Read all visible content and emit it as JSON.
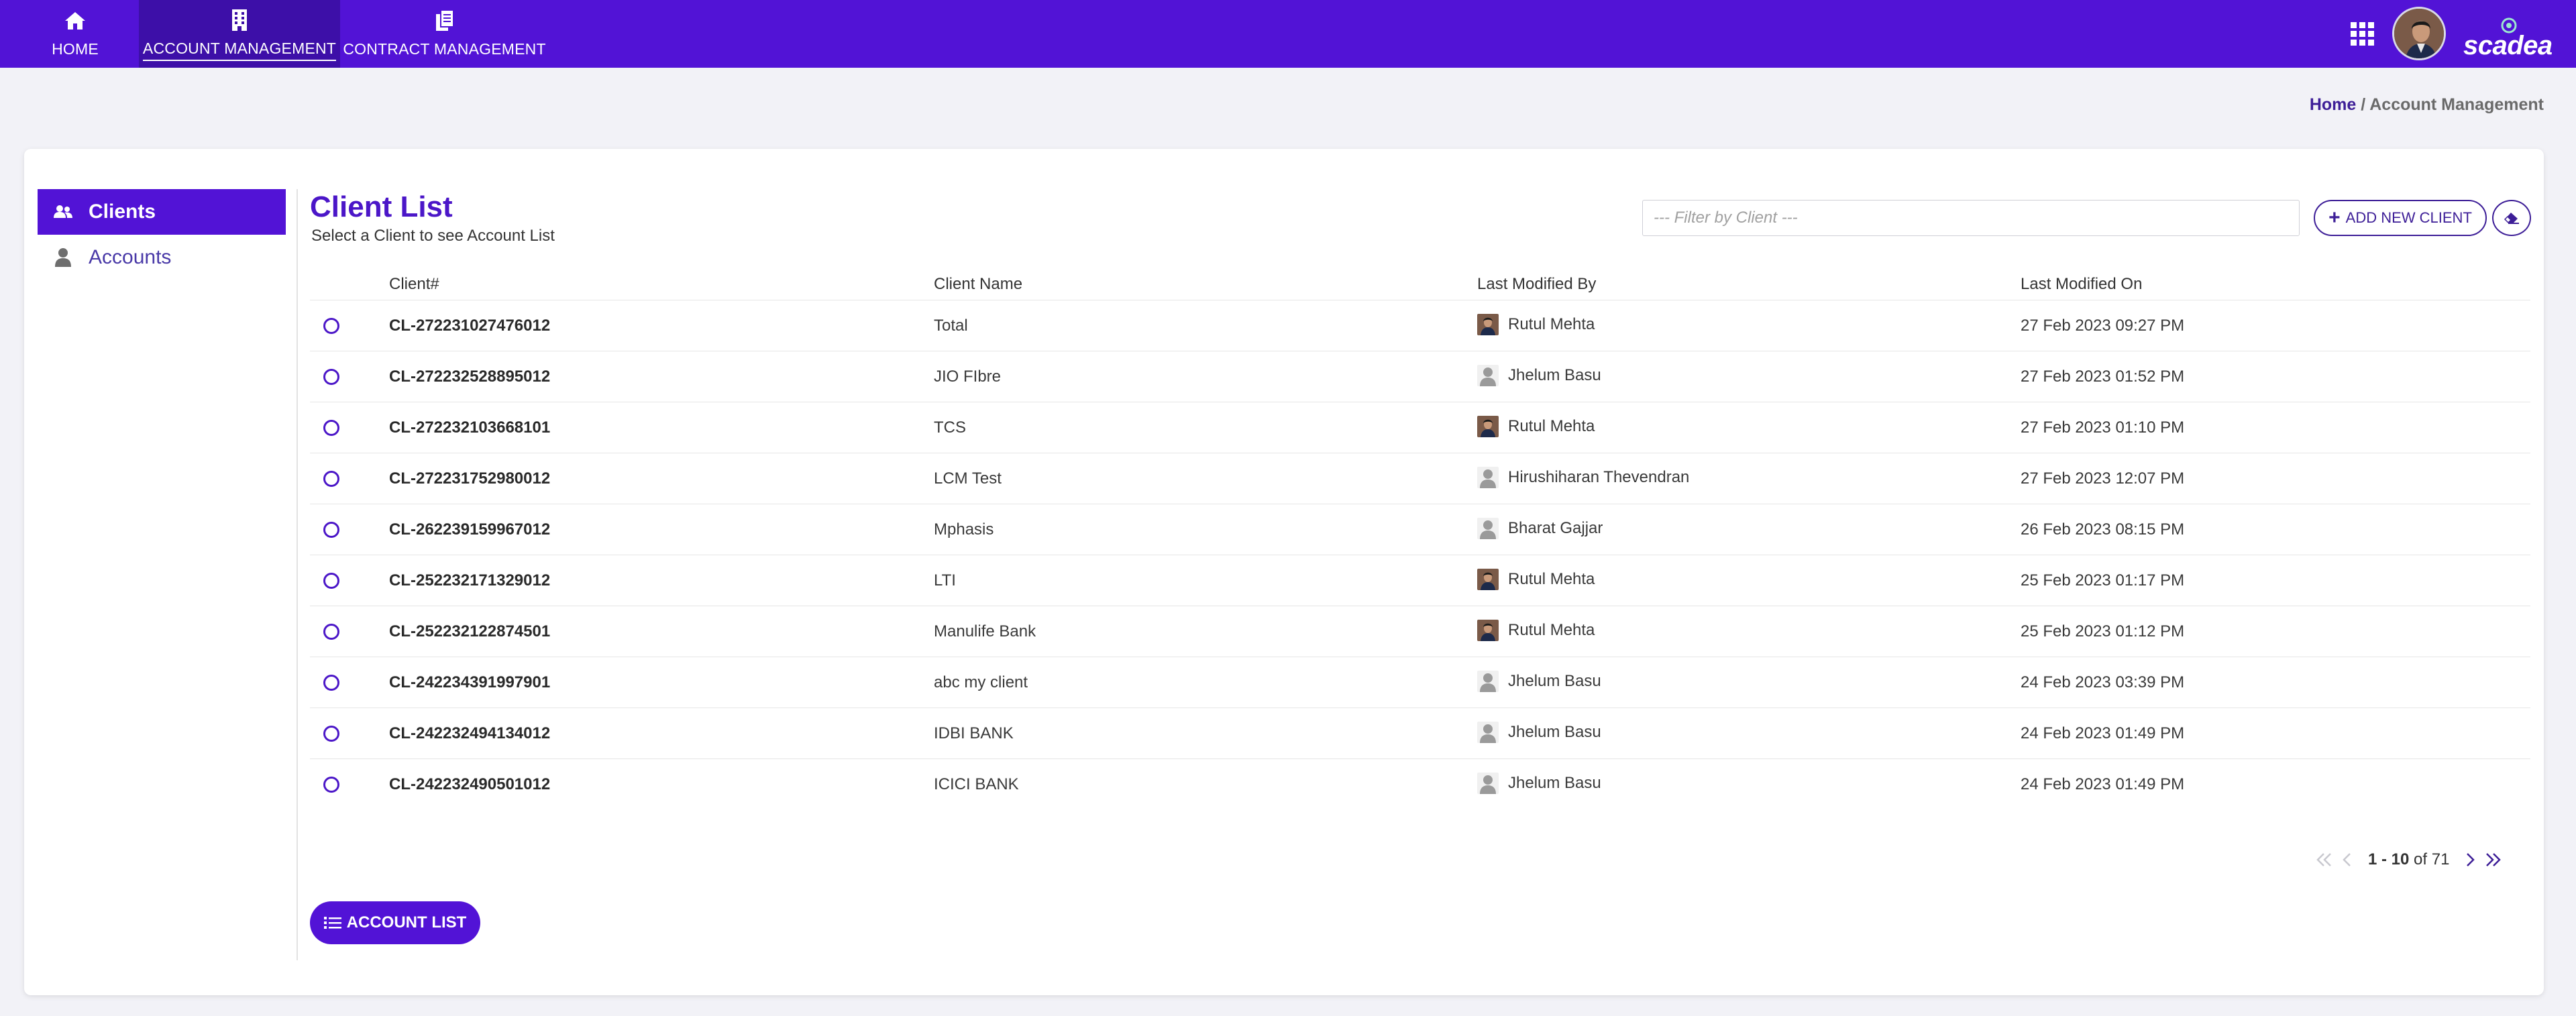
{
  "nav": {
    "items": [
      {
        "label": "HOME",
        "icon": "home-icon"
      },
      {
        "label": "ACCOUNT MANAGEMENT",
        "icon": "building-icon",
        "active": true
      },
      {
        "label": "CONTRACT MANAGEMENT",
        "icon": "documents-icon"
      }
    ],
    "brand": "scadea",
    "colors": {
      "primary": "#5213d6",
      "active_bg": "#3d0fa8"
    }
  },
  "breadcrumb": {
    "home": "Home",
    "separator": " / ",
    "current": "Account Management"
  },
  "sidebar": {
    "items": [
      {
        "label": "Clients",
        "icon": "users-icon",
        "active": true
      },
      {
        "label": "Accounts",
        "icon": "user-icon",
        "active": false
      }
    ]
  },
  "header": {
    "title": "Client List",
    "subtitle": "Select a Client to see Account List",
    "filter_placeholder": "--- Filter by Client ---",
    "add_button": "ADD NEW CLIENT",
    "add_icon": "+"
  },
  "table": {
    "columns": [
      "Client#",
      "Client Name",
      "Last Modified By",
      "Last Modified On"
    ],
    "rows": [
      {
        "id": "CL-272231027476012",
        "name": "Total",
        "by": "Rutul Mehta",
        "by_avatar": "photo",
        "on": "27 Feb 2023 09:27 PM"
      },
      {
        "id": "CL-272232528895012",
        "name": "JIO FIbre",
        "by": "Jhelum Basu",
        "by_avatar": "placeholder",
        "on": "27 Feb 2023 01:52 PM"
      },
      {
        "id": "CL-272232103668101",
        "name": "TCS",
        "by": "Rutul Mehta",
        "by_avatar": "photo",
        "on": "27 Feb 2023 01:10 PM"
      },
      {
        "id": "CL-272231752980012",
        "name": "LCM Test",
        "by": "Hirushiharan Thevendran",
        "by_avatar": "placeholder",
        "on": "27 Feb 2023 12:07 PM"
      },
      {
        "id": "CL-262239159967012",
        "name": "Mphasis",
        "by": "Bharat Gajjar",
        "by_avatar": "placeholder",
        "on": "26 Feb 2023 08:15 PM"
      },
      {
        "id": "CL-252232171329012",
        "name": "LTI",
        "by": "Rutul Mehta",
        "by_avatar": "photo",
        "on": "25 Feb 2023 01:17 PM"
      },
      {
        "id": "CL-252232122874501",
        "name": "Manulife Bank",
        "by": "Rutul Mehta",
        "by_avatar": "photo",
        "on": "25 Feb 2023 01:12 PM"
      },
      {
        "id": "CL-242234391997901",
        "name": "abc my client",
        "by": "Jhelum Basu",
        "by_avatar": "placeholder",
        "on": "24 Feb 2023 03:39 PM"
      },
      {
        "id": "CL-242232494134012",
        "name": "IDBI BANK",
        "by": "Jhelum Basu",
        "by_avatar": "placeholder",
        "on": "24 Feb 2023 01:49 PM"
      },
      {
        "id": "CL-242232490501012",
        "name": "ICICI BANK",
        "by": "Jhelum Basu",
        "by_avatar": "placeholder",
        "on": "24 Feb 2023 01:49 PM"
      }
    ]
  },
  "pagination": {
    "range": "1 - 10",
    "of": "of",
    "total": "71"
  },
  "footer": {
    "account_list_button": "ACCOUNT LIST"
  }
}
